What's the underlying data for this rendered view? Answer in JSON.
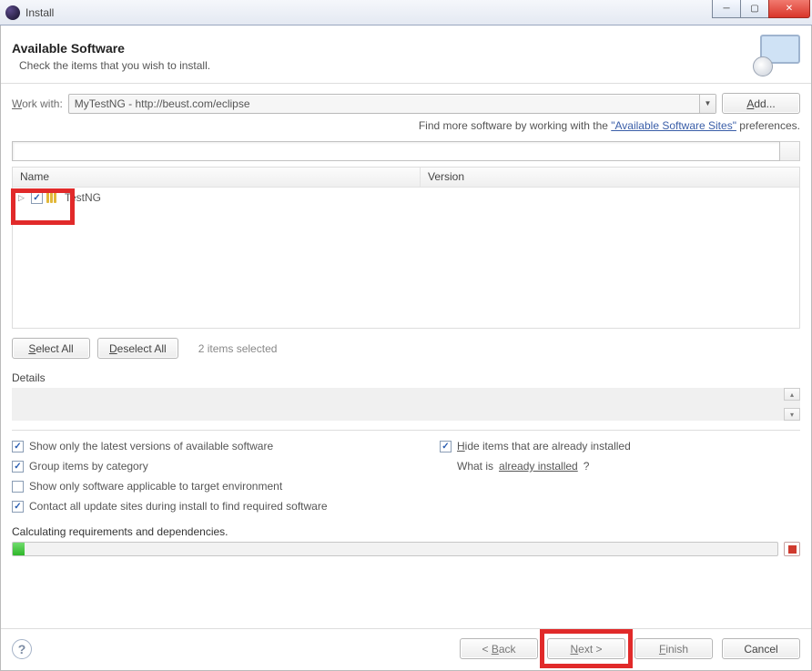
{
  "window": {
    "title": "Install"
  },
  "banner": {
    "title": "Available Software",
    "subtitle": "Check the items that you wish to install."
  },
  "work_with": {
    "label_pre": "W",
    "label_post": "ork with:",
    "value": "MyTestNG - http://beust.com/eclipse",
    "add_label": "Add..."
  },
  "hint": {
    "pre": "Find more software by working with the ",
    "link": "\"Available Software Sites\"",
    "post": " preferences."
  },
  "tree": {
    "columns": {
      "name": "Name",
      "version": "Version"
    },
    "items": [
      {
        "label": "TestNG",
        "checked": true
      }
    ]
  },
  "selection": {
    "select_all": "Select All",
    "deselect_all": "Deselect All",
    "count_text": "2 items selected"
  },
  "details": {
    "label": "Details"
  },
  "options": {
    "left": [
      {
        "label": "Show only the latest versions of available software",
        "checked": true
      },
      {
        "label": "Group items by category",
        "checked": true
      },
      {
        "label": "Show only software applicable to target environment",
        "checked": false
      },
      {
        "label": "Contact all update sites during install to find required software",
        "checked": true
      }
    ],
    "right": [
      {
        "label": "Hide items that are already installed",
        "checked": true
      },
      {
        "label_pre": "What is ",
        "link": "already installed",
        "label_post": "?"
      }
    ]
  },
  "status": {
    "text": "Calculating requirements and dependencies."
  },
  "footer": {
    "back": "< Back",
    "next": "Next >",
    "finish": "Finish",
    "cancel": "Cancel"
  }
}
